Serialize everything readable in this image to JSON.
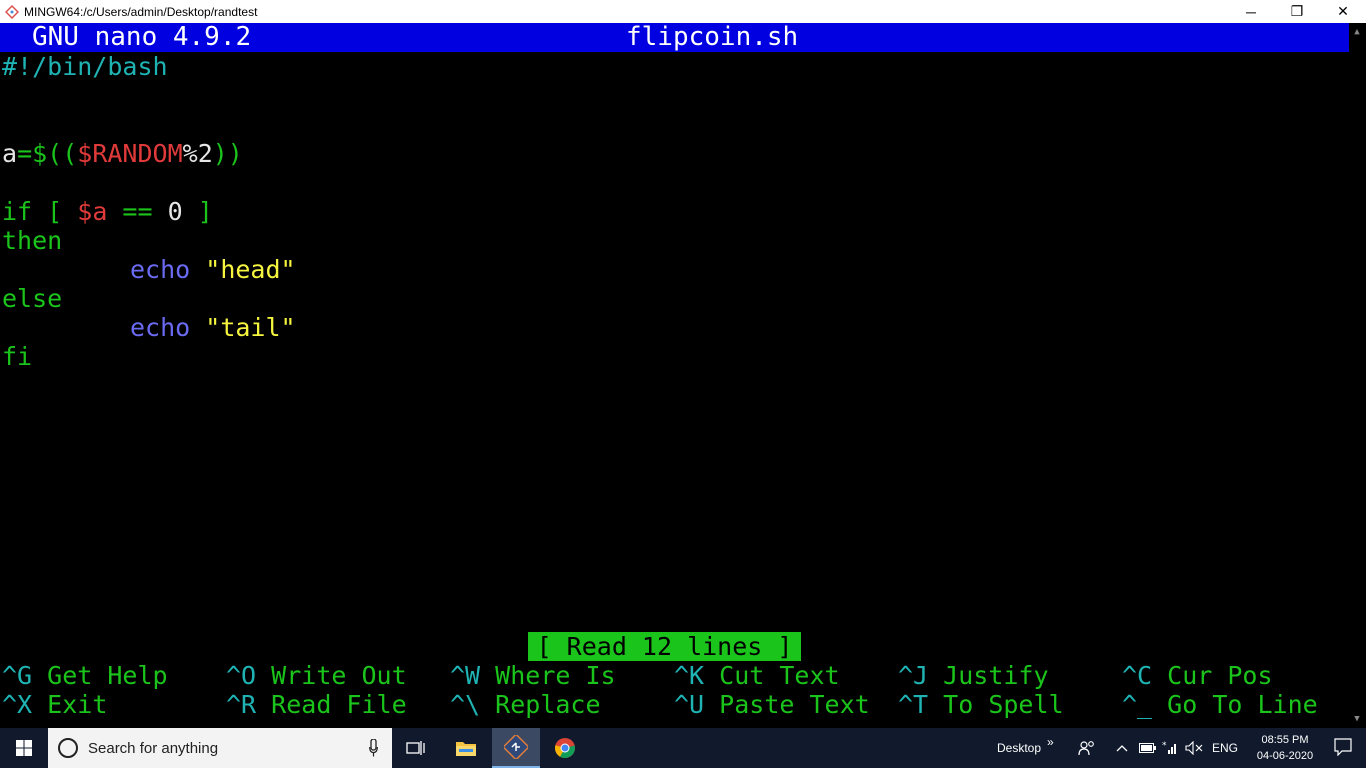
{
  "window": {
    "title": "MINGW64:/c/Users/admin/Desktop/randtest",
    "minimize": "─",
    "maximize": "❐",
    "close": "✕"
  },
  "nano": {
    "version": "GNU nano 4.9.2",
    "filename": "flipcoin.sh",
    "status": "[ Read 12 lines ]"
  },
  "code": {
    "line1": "#!/bin/bash",
    "l5_a": "a",
    "l5_eq": "=$((",
    "l5_var": "$RANDOM",
    "l5_rest": "%2",
    "l5_close": "))",
    "l7_if": "if [ ",
    "l7_var": "$a",
    "l7_op": " == ",
    "l7_num": "0",
    "l7_end": " ]",
    "l8": "then",
    "l9_echo": "echo",
    "l9_str": "\"head\"",
    "l10": "else",
    "l11_echo": "echo",
    "l11_str": "\"tail\"",
    "l12": "fi"
  },
  "shortcuts": [
    {
      "key": "^G",
      "label": "Get Help"
    },
    {
      "key": "^O",
      "label": "Write Out"
    },
    {
      "key": "^W",
      "label": "Where Is"
    },
    {
      "key": "^K",
      "label": "Cut Text"
    },
    {
      "key": "^J",
      "label": "Justify"
    },
    {
      "key": "^C",
      "label": "Cur Pos"
    },
    {
      "key": "^X",
      "label": "Exit"
    },
    {
      "key": "^R",
      "label": "Read File"
    },
    {
      "key": "^\\",
      "label": "Replace"
    },
    {
      "key": "^U",
      "label": "Paste Text"
    },
    {
      "key": "^T",
      "label": "To Spell"
    },
    {
      "key": "^_",
      "label": "Go To Line"
    }
  ],
  "taskbar": {
    "search_placeholder": "Search for anything",
    "desktop_label": "Desktop",
    "chevron": "»",
    "lang": "ENG",
    "time": "08:55 PM",
    "date": "04-06-2020"
  },
  "colors": {
    "header_bg": "#0000e0",
    "cyan": "#1fb3b3",
    "green": "#1bc41b",
    "red": "#e03a3a",
    "yellow": "#f5f540",
    "blue": "#6a6af2"
  }
}
